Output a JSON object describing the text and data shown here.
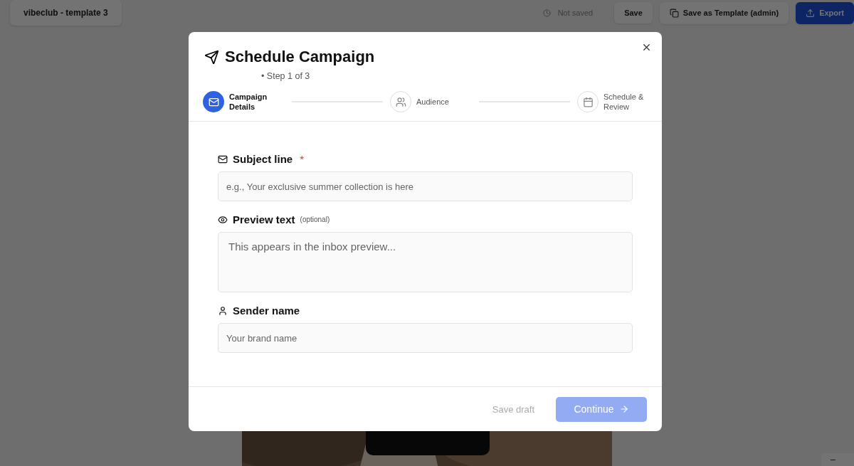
{
  "topbar": {
    "title": "vibeclub - template 3",
    "status": "Not saved",
    "buttons": [
      {
        "label": "Save",
        "kind": "plain"
      },
      {
        "label": "Save as Template (admin)",
        "kind": "template"
      },
      {
        "label": "Export",
        "kind": "primary"
      }
    ]
  },
  "canvas": {
    "zoom_out": "−"
  },
  "dialog": {
    "title": "Schedule Campaign",
    "step": "• Step 1 of 3",
    "steps": [
      {
        "label": "Campaign Details",
        "selected": true
      },
      {
        "label": "Audience",
        "selected": false
      },
      {
        "label": "Schedule & Review",
        "selected": false
      }
    ],
    "fields": [
      {
        "label": "Subject line",
        "kind": "input",
        "required_mark": "*",
        "placeholder": "e.g., Your exclusive summer collection is here"
      },
      {
        "label": "Preview text",
        "kind": "textarea",
        "hint": "(optional)",
        "placeholder": "This appears in the inbox preview..."
      },
      {
        "label": "Sender name",
        "kind": "input",
        "placeholder": "Your brand name"
      }
    ],
    "save_draft": {
      "label": "Save draft",
      "disabled": true
    },
    "continue": {
      "label": "Continue",
      "disabled": true
    }
  }
}
